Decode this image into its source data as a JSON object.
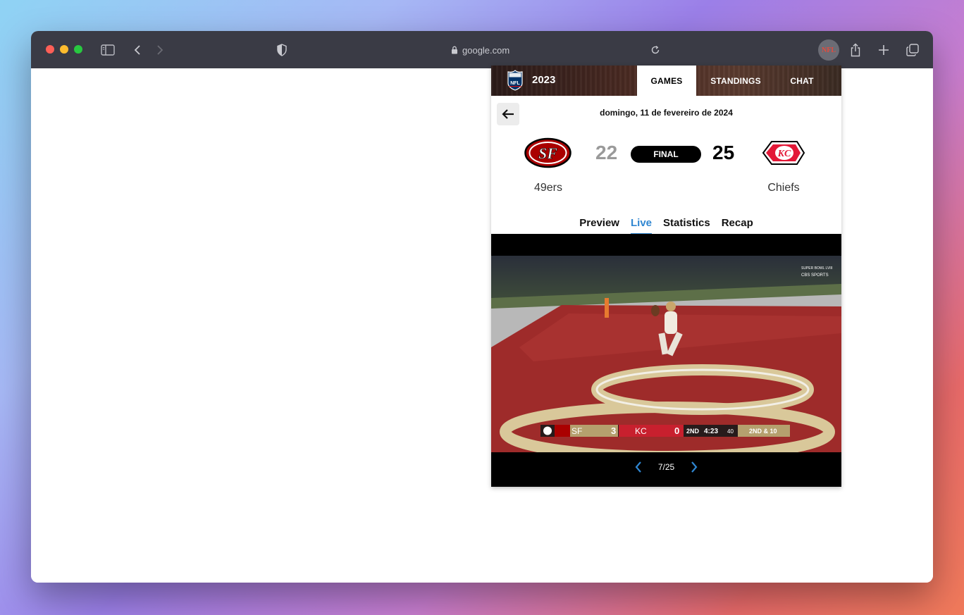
{
  "browser": {
    "url": "google.com",
    "extension_label": "NFL"
  },
  "widget": {
    "season": "2023",
    "tabs": [
      "GAMES",
      "STANDINGS",
      "CHAT"
    ],
    "active_tab": "GAMES",
    "date": "domingo, 11 de fevereiro de 2024",
    "game": {
      "home_team": "49ers",
      "home_score": "22",
      "away_team": "Chiefs",
      "away_score": "25",
      "status": "FINAL"
    },
    "sub_tabs": [
      "Preview",
      "Live",
      "Statistics",
      "Recap"
    ],
    "active_sub_tab": "Live",
    "video": {
      "counter": "7/25",
      "scorebug": {
        "team1": "SF",
        "score1": "3",
        "team2": "KC",
        "score2": "0",
        "quarter": "2ND",
        "clock": "4:23",
        "play_clock": "40",
        "down": "2ND & 10",
        "corner_logo_line1": "SUPER BOWL LVIII",
        "corner_logo_line2": "CBS SPORTS"
      }
    }
  },
  "colors": {
    "accent": "#2f86d1",
    "niners_red": "#aa0000",
    "chiefs_red": "#e31837",
    "toolbar": "#3a3b45"
  }
}
